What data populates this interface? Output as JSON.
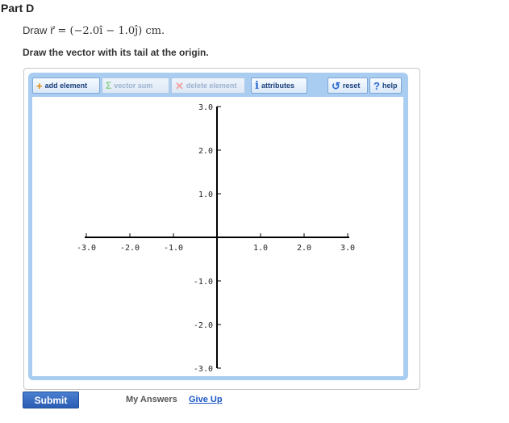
{
  "part": {
    "title": "Part D"
  },
  "prompt": {
    "draw_word": "Draw",
    "equation": "r⃗ = (−2.0î − 1.0ĵ) cm."
  },
  "instruction": "Draw the vector with its tail at the origin.",
  "toolbar": {
    "add_element": "add element",
    "vector_sum": "vector sum",
    "delete_element": "delete element",
    "attributes": "attributes",
    "reset": "reset",
    "help": "help"
  },
  "icons": {
    "add": "plus-icon",
    "sum": "sigma-icon",
    "delete": "x-icon",
    "attributes": "info-icon",
    "reset": "reset-icon",
    "help": "question-icon"
  },
  "axes": {
    "x_ticks": [
      "-3.0",
      "-2.0",
      "-1.0",
      "1.0",
      "2.0",
      "3.0"
    ],
    "y_ticks": [
      "3.0",
      "2.0",
      "1.0",
      "-1.0",
      "-2.0",
      "-3.0"
    ],
    "range": [
      -3,
      3
    ]
  },
  "footer": {
    "submit": "Submit",
    "my_answers": "My Answers",
    "give_up": "Give Up"
  },
  "colors": {
    "frame_blue": "#a9cdf1",
    "submit_blue": "#2a5db4",
    "link_blue": "#1a57c7"
  }
}
